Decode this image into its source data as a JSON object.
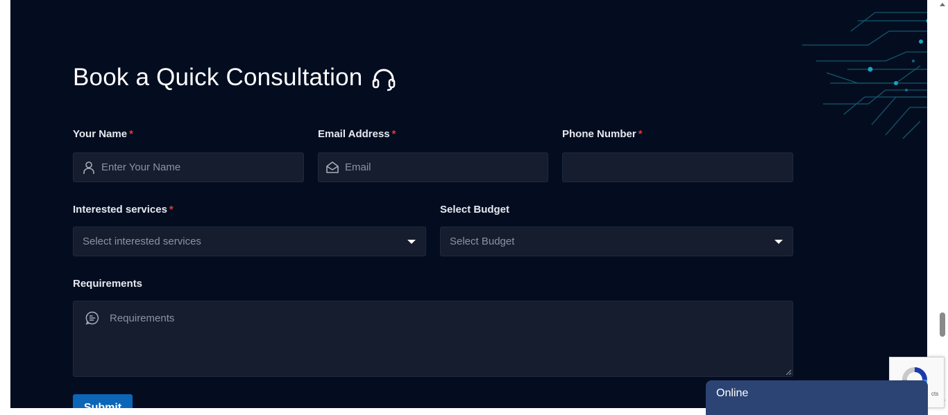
{
  "heading": {
    "title": "Book a Quick Consultation",
    "icon": "headset-icon"
  },
  "form": {
    "name": {
      "label": "Your Name",
      "required_mark": "*",
      "placeholder": "Enter Your Name",
      "value": ""
    },
    "email": {
      "label": "Email Address",
      "required_mark": "*",
      "placeholder": "Email",
      "value": ""
    },
    "phone": {
      "label": "Phone Number",
      "required_mark": "*",
      "placeholder": "",
      "value": ""
    },
    "services": {
      "label": "Interested services",
      "required_mark": "*",
      "selected": "Select interested services"
    },
    "budget": {
      "label": "Select Budget",
      "selected": "Select Budget"
    },
    "requirements": {
      "label": "Requirements",
      "placeholder": "Requirements",
      "value": ""
    },
    "submit_label": "Submit"
  },
  "chat_widget": {
    "status": "Online"
  },
  "recaptcha": {
    "text": "cts"
  },
  "colors": {
    "background": "#040d20",
    "field_bg": "#151d2e",
    "required": "#e53935",
    "submit": "#0b66b8",
    "chat": "#2c4474"
  }
}
